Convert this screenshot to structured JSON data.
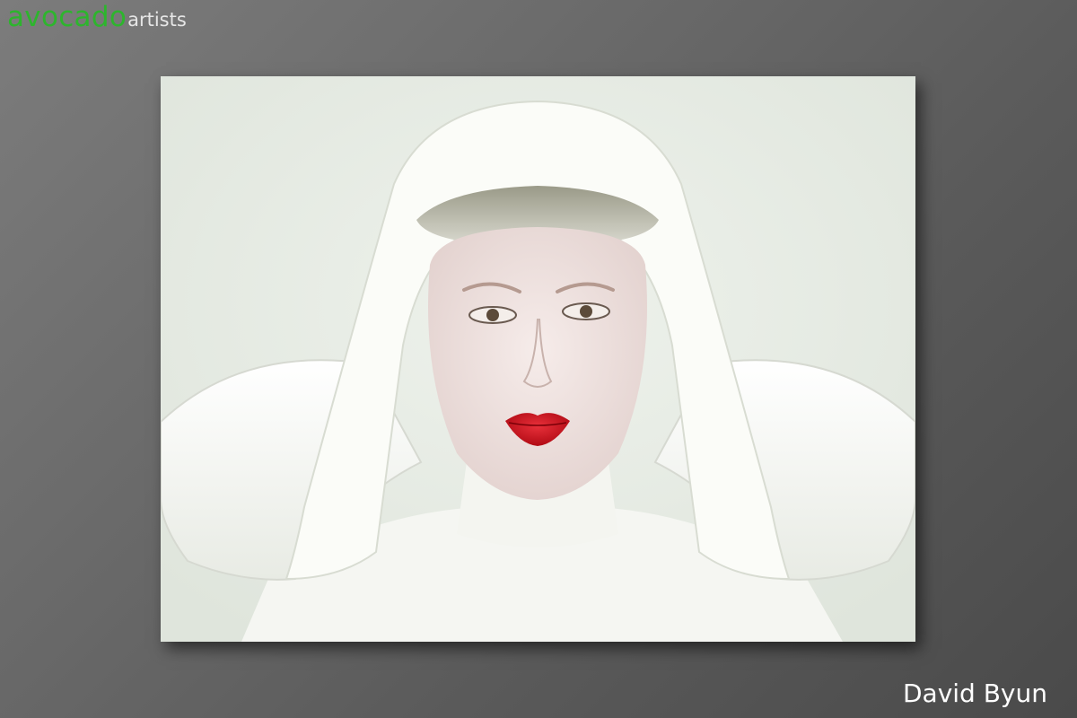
{
  "brand": {
    "name_main": "avocado",
    "name_sub": "artists",
    "main_color": "#2db52d",
    "sub_color": "#e6e6e6"
  },
  "gallery": {
    "photographer": "David Byun",
    "photographer_color": "#ffffff",
    "photo_icon": "portrait-photo",
    "background_color": "#e2e8df",
    "garment_color": "#f7f8f4",
    "lip_color": "#c8101a"
  }
}
